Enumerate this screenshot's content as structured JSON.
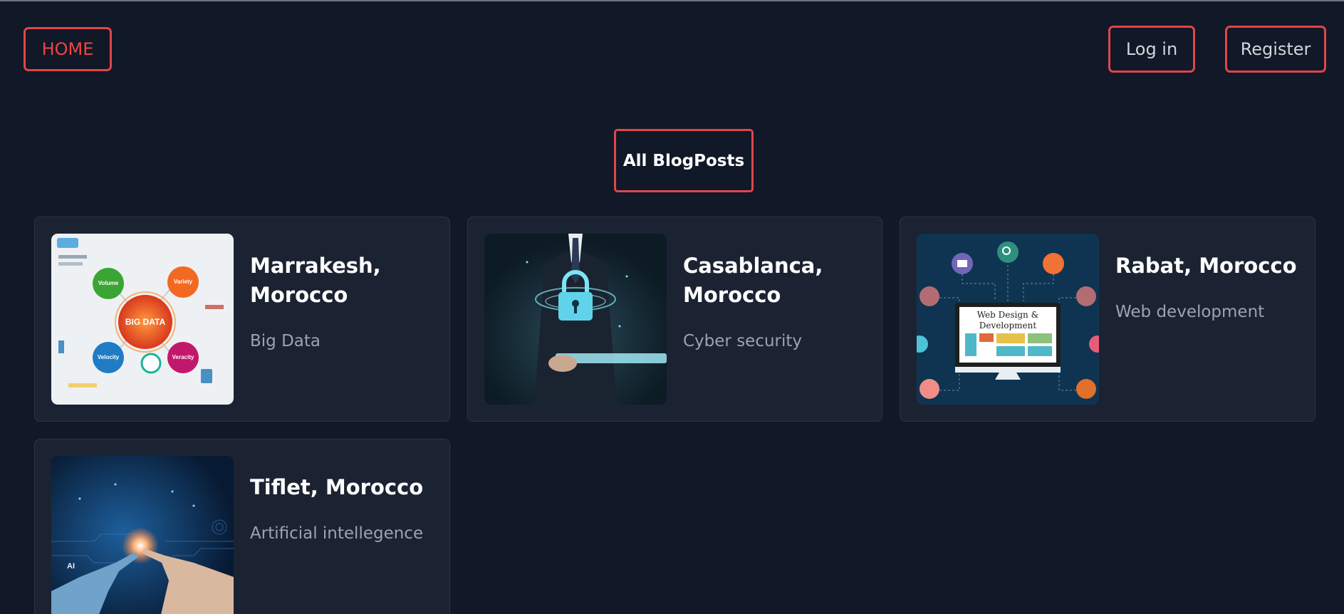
{
  "nav": {
    "home_label": "HOME",
    "login_label": "Log in",
    "register_label": "Register"
  },
  "main": {
    "heading_button_label": "All BlogPosts"
  },
  "posts": [
    {
      "title": "Marrakesh, Morocco",
      "category": "Big Data",
      "image_text": {
        "center": "BIG DATA",
        "volume": "Volume",
        "variety": "Variety",
        "velocity": "Velocity",
        "veracity": "Veracity"
      }
    },
    {
      "title": "Casablanca, Morocco",
      "category": "Cyber security"
    },
    {
      "title": "Rabat, Morocco",
      "category": "Web development",
      "image_text": {
        "line1": "Web Design &",
        "line2": "Development"
      }
    },
    {
      "title": "Tiflet, Morocco",
      "category": "Artificial intellegence",
      "image_text": {
        "ai": "AI"
      }
    }
  ],
  "colors": {
    "page_background": "#111827",
    "card_background": "#1b2332",
    "accent_border": "#e0464a",
    "home_text": "#ef4444"
  }
}
